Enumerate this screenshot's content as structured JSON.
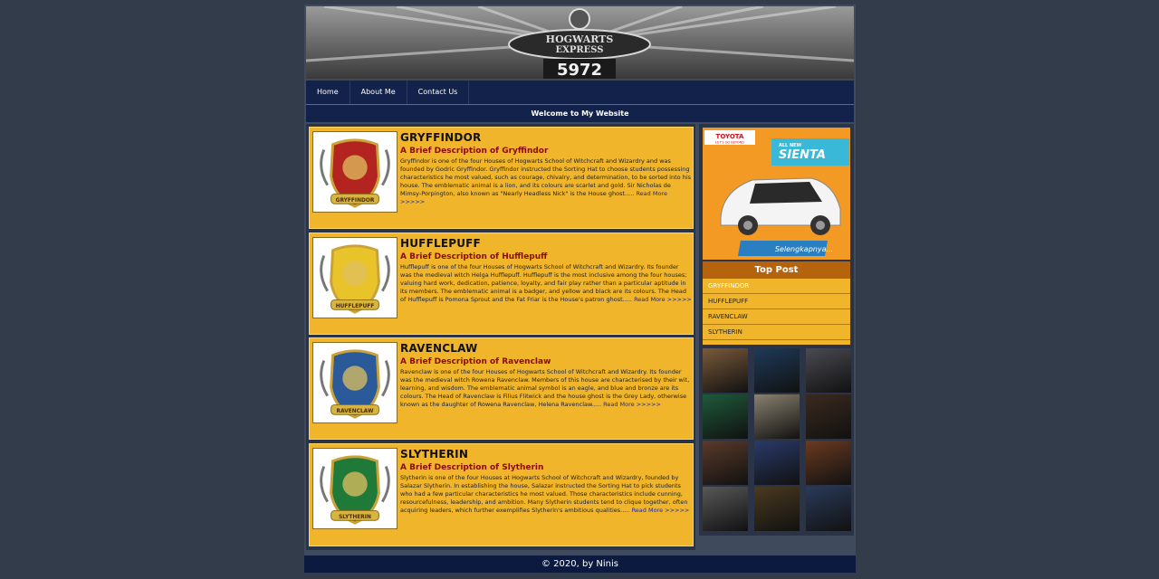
{
  "banner": {
    "plate_line1": "HOGWARTS",
    "plate_line2": "EXPRESS",
    "number": "5972"
  },
  "nav": [
    {
      "label": "Home"
    },
    {
      "label": "About Me"
    },
    {
      "label": "Contact Us"
    }
  ],
  "welcome": "Welcome to My Website",
  "posts": [
    {
      "title": "GRYFFINDOR",
      "subtitle": "A Brief Description of Gryffindor",
      "body": "Gryffindor is one of the four Houses of Hogwarts School of Witchcraft and Wizardry and was founded by Godric Gryffindor. Gryffindor instructed the Sorting Hat to choose students possessing characteristics he most valued, such as courage, chivalry, and determination, to be sorted into his house. The emblematic animal is a lion, and its colours are scarlet and gold. Sir Nicholas de Mimsy-Porpington, also known as \"Nearly Headless Nick\" is the House ghost.....",
      "more": "Read More >>>>>",
      "crest_label": "GRYFFINDOR",
      "crest_color": "#b3231f"
    },
    {
      "title": "HUFFLEPUFF",
      "subtitle": "A Brief Description of Hufflepuff",
      "body": "Hufflepuff is one of the four Houses of Hogwarts School of Witchcraft and Wizardry. Its founder was the medieval witch Helga Hufflepuff. Hufflepuff is the most inclusive among the four houses; valuing hard work, dedication, patience, loyalty, and fair play rather than a particular aptitude in its members. The emblematic animal is a badger, and yellow and black are its colours. The Head of Hufflepuff is Pomona Sprout and the Fat Friar is the House's patron ghost.....",
      "more": "Read More >>>>>",
      "crest_label": "HUFFLEPUFF",
      "crest_color": "#e8c42a"
    },
    {
      "title": "RAVENCLAW",
      "subtitle": "A Brief Description of Ravenclaw",
      "body": "Ravenclaw is one of the four Houses of Hogwarts School of Witchcraft and Wizardry. Its founder was the medieval witch Rowena Ravenclaw. Members of this house are characterised by their wit, learning, and wisdom. The emblematic animal symbol is an eagle, and blue and bronze are its colours. The Head of Ravenclaw is Filius Flitwick and the house ghost is the Grey Lady, otherwise known as the daughter of Rowena Ravenclaw, Helena Ravenclaw.....",
      "more": "Read More >>>>>",
      "crest_label": "RAVENCLAW",
      "crest_color": "#2a5a9a"
    },
    {
      "title": "SLYTHERIN",
      "subtitle": "A Brief Description of Slytherin",
      "body": "Slytherin is one of the four Houses at Hogwarts School of Witchcraft and Wizardry, founded by Salazar Slytherin. In establishing the house, Salazar instructed the Sorting Hat to pick students who had a few particular characteristics he most valued. Those characteristics include cunning, resourcefulness, leadership, and ambition. Many Slytherin students tend to clique together, often acquiring leaders, which further exemplifies Slytherin's ambitious qualities.....",
      "more": "Read More >>>>>",
      "crest_label": "SLYTHERIN",
      "crest_color": "#1f7a3a"
    }
  ],
  "ad": {
    "brand": "TOYOTA",
    "tagline": "LET'S GO BEYOND",
    "badge": "ALL NEW",
    "model": "SIENTA",
    "cta": "Selengkapnya..."
  },
  "top_post": {
    "title": "Top Post",
    "items": [
      "GRYFFINDOR",
      "HUFFLEPUFF",
      "RAVENCLAW",
      "SLYTHERIN"
    ]
  },
  "gallery_colors": [
    "#7a5a3a",
    "#1e3a5a",
    "#4a4a52",
    "#1e5a3a",
    "#8a8270",
    "#3a2a1e",
    "#5a3a2a",
    "#2a3a6a",
    "#6a3a20",
    "#585858",
    "#4a3a20",
    "#2a3a5a"
  ],
  "footer": "© 2020, by Ninis"
}
